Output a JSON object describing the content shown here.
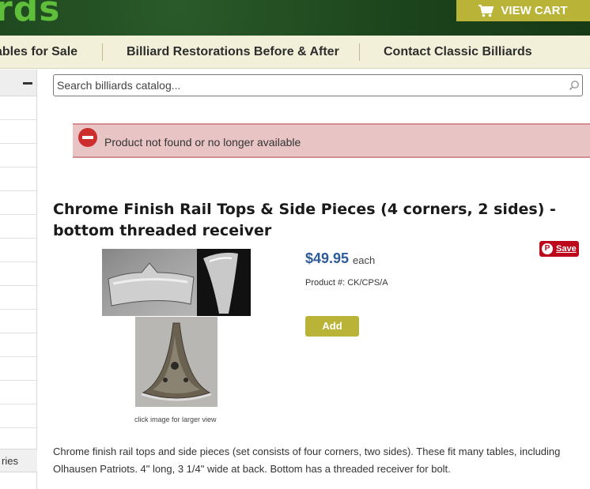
{
  "header": {
    "logo_text": "rds",
    "view_cart_label": "VIEW CART"
  },
  "nav": {
    "items": [
      {
        "label": "ables for Sale"
      },
      {
        "label": "Billiard Restorations Before & After"
      },
      {
        "label": "Contact Classic Billiards"
      }
    ]
  },
  "sidebar": {
    "category_label": "ries"
  },
  "search": {
    "placeholder": "Search billiards catalog..."
  },
  "alert": {
    "message": "Product not found or no longer available"
  },
  "product": {
    "title": "Chrome Finish Rail Tops & Side Pieces (4 corners, 2 sides) - bottom threaded receiver",
    "price": "$49.95",
    "price_unit": "each",
    "sku": "Product #: CK/CPS/A",
    "add_label": "Add",
    "image_caption": "click image for larger view",
    "pin_label": "Save",
    "description": "Chrome finish rail tops and side pieces (set consists of four corners, two sides). These fit many tables, including Olhausen Patriots. 4\" long, 3 1/4\" wide at back. Bottom has a threaded receiver for bolt."
  },
  "colors": {
    "header_green": "#1f4a1f",
    "accent_olive": "#b9b338",
    "price_blue": "#2e5c99",
    "alert_bg": "#e9c4c5",
    "pinterest_red": "#bd081c"
  }
}
